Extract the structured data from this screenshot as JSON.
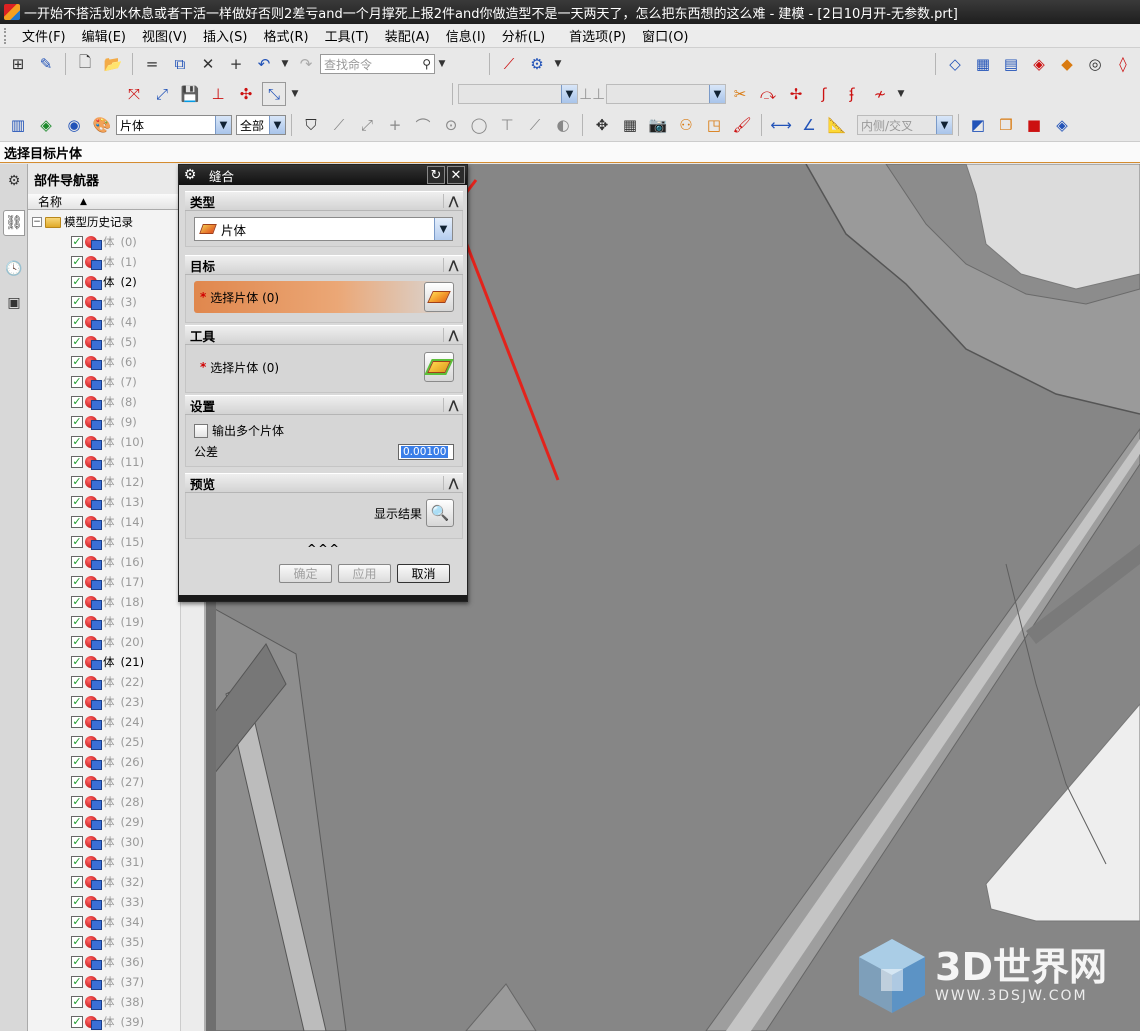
{
  "window": {
    "title": "一开始不搭活划水休息或者干活一样做好否则2差亏and一个月撑死上报2件and你做造型不是一天两天了，怎么把东西想的这么难 - 建模 - [2日10月开-无参数.prt]"
  },
  "menu": {
    "items": [
      "文件(F)",
      "编辑(E)",
      "视图(V)",
      "插入(S)",
      "格式(R)",
      "工具(T)",
      "装配(A)",
      "信息(I)",
      "分析(L)",
      "首选项(P)",
      "窗口(O)"
    ]
  },
  "toolbar": {
    "search_placeholder": "查找命令",
    "filter_type": "片体",
    "filter_scope": "全部",
    "snap_combo": "内侧/交叉"
  },
  "cue": {
    "text": "选择目标片体"
  },
  "navigator": {
    "title": "部件导航器",
    "column_name": "名称",
    "root_label": "模型历史记录",
    "body_label": "体",
    "items": [
      {
        "num": "(0)",
        "bright": false
      },
      {
        "num": "(1)",
        "bright": false
      },
      {
        "num": "(2)",
        "bright": true
      },
      {
        "num": "(3)",
        "bright": false
      },
      {
        "num": "(4)",
        "bright": false
      },
      {
        "num": "(5)",
        "bright": false
      },
      {
        "num": "(6)",
        "bright": false
      },
      {
        "num": "(7)",
        "bright": false
      },
      {
        "num": "(8)",
        "bright": false
      },
      {
        "num": "(9)",
        "bright": false
      },
      {
        "num": "(10)",
        "bright": false
      },
      {
        "num": "(11)",
        "bright": false
      },
      {
        "num": "(12)",
        "bright": false
      },
      {
        "num": "(13)",
        "bright": false
      },
      {
        "num": "(14)",
        "bright": false
      },
      {
        "num": "(15)",
        "bright": false
      },
      {
        "num": "(16)",
        "bright": false
      },
      {
        "num": "(17)",
        "bright": false
      },
      {
        "num": "(18)",
        "bright": false
      },
      {
        "num": "(19)",
        "bright": false
      },
      {
        "num": "(20)",
        "bright": false
      },
      {
        "num": "(21)",
        "bright": true
      },
      {
        "num": "(22)",
        "bright": false
      },
      {
        "num": "(23)",
        "bright": false
      },
      {
        "num": "(24)",
        "bright": false
      },
      {
        "num": "(25)",
        "bright": false
      },
      {
        "num": "(26)",
        "bright": false
      },
      {
        "num": "(27)",
        "bright": false
      },
      {
        "num": "(28)",
        "bright": false
      },
      {
        "num": "(29)",
        "bright": false
      },
      {
        "num": "(30)",
        "bright": false
      },
      {
        "num": "(31)",
        "bright": false
      },
      {
        "num": "(32)",
        "bright": false
      },
      {
        "num": "(33)",
        "bright": false
      },
      {
        "num": "(34)",
        "bright": false
      },
      {
        "num": "(35)",
        "bright": false
      },
      {
        "num": "(36)",
        "bright": false
      },
      {
        "num": "(37)",
        "bright": false
      },
      {
        "num": "(38)",
        "bright": false
      },
      {
        "num": "(39)",
        "bright": false
      }
    ]
  },
  "dialog": {
    "title": "缝合",
    "type_section": "类型",
    "type_value": "片体",
    "target_section": "目标",
    "target_select": "选择片体 (0)",
    "tool_section": "工具",
    "tool_select": "选择片体 (0)",
    "settings_section": "设置",
    "output_multiple_label": "输出多个片体",
    "tolerance_label": "公差",
    "tolerance_value": "0.00100",
    "preview_section": "预览",
    "show_result_label": "显示结果",
    "more_indicator": "^^^",
    "ok_label": "确定",
    "apply_label": "应用",
    "cancel_label": "取消"
  },
  "watermark": {
    "main": "3D世界网",
    "url": "WWW.3DSJW.COM"
  }
}
